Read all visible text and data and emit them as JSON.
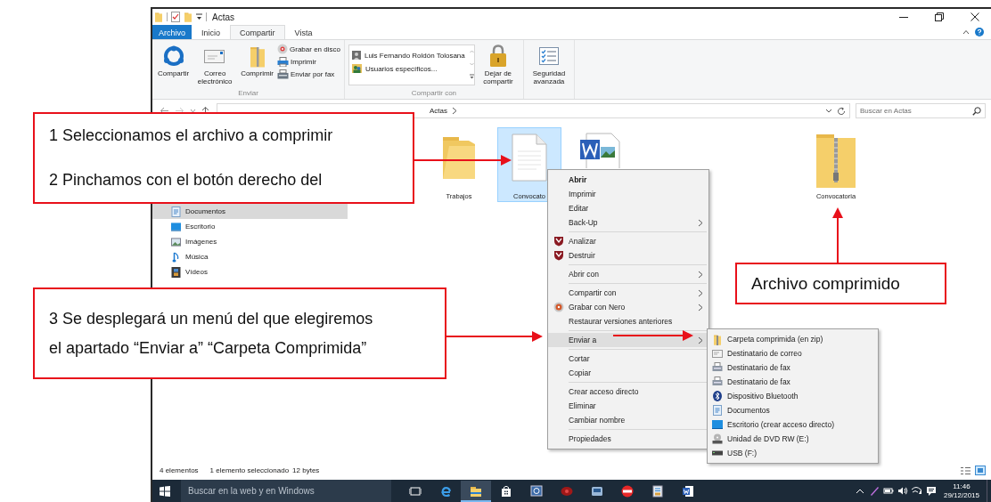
{
  "window": {
    "title": "Actas"
  },
  "ribbon_tabs": [
    {
      "label": "Archivo",
      "kind": "file",
      "selected": false
    },
    {
      "label": "Inicio",
      "kind": "tab",
      "selected": false
    },
    {
      "label": "Compartir",
      "kind": "tab",
      "selected": true
    },
    {
      "label": "Vista",
      "kind": "tab",
      "selected": false
    }
  ],
  "ribbon": {
    "send_group": {
      "label": "Enviar",
      "large_buttons": [
        "Compartir",
        "Correo electrónico",
        "Comprimir"
      ],
      "small_buttons": [
        "Grabar en disco",
        "Imprimir",
        "Enviar por fax"
      ]
    },
    "share_group": {
      "label": "Compartir con",
      "people": [
        "Luis Fernando Roldón Tolosana",
        "Usuarios específicos..."
      ],
      "stop_button": "Dejar de compartir"
    },
    "security_button": "Seguridad avanzada"
  },
  "address_bar": {
    "breadcrumb": [
      "Actas"
    ],
    "search_placeholder": "Buscar en Actas"
  },
  "nav_items": [
    {
      "label": "Documentos",
      "selected": true
    },
    {
      "label": "Escritorio",
      "selected": false
    },
    {
      "label": "Imágenes",
      "selected": false
    },
    {
      "label": "Música",
      "selected": false
    },
    {
      "label": "Vídeos",
      "selected": false
    }
  ],
  "files": [
    {
      "label": "Trabajos",
      "kind": "folder",
      "selected": false
    },
    {
      "label": "Convocato",
      "kind": "text",
      "selected": true
    },
    {
      "kind": "word",
      "selected": false
    },
    {
      "label": "Convocatoria",
      "kind": "zip",
      "selected": false
    }
  ],
  "context_menu": [
    [
      {
        "label": "Abrir",
        "kind": "default",
        "submenu": false,
        "selected": false
      },
      {
        "label": "Imprimir",
        "kind": "plain",
        "submenu": false,
        "selected": false
      },
      {
        "label": "Editar",
        "kind": "plain",
        "submenu": false,
        "selected": false
      },
      {
        "label": "Back-Up",
        "kind": "plain",
        "submenu": true,
        "selected": false
      }
    ],
    [
      {
        "label": "Analizar",
        "kind": "shield",
        "submenu": false,
        "selected": false
      },
      {
        "label": "Destruir",
        "kind": "shield",
        "submenu": false,
        "selected": false
      }
    ],
    [
      {
        "label": "Abrir con",
        "kind": "plain",
        "submenu": true,
        "selected": false
      }
    ],
    [
      {
        "label": "Compartir con",
        "kind": "plain",
        "submenu": true,
        "selected": false
      },
      {
        "label": "Grabar con Nero",
        "kind": "nero",
        "submenu": true,
        "selected": false
      },
      {
        "label": "Restaurar versiones anteriores",
        "kind": "plain",
        "submenu": false,
        "selected": false
      }
    ],
    [
      {
        "label": "Enviar a",
        "kind": "plain",
        "submenu": true,
        "selected": true
      }
    ],
    [
      {
        "label": "Cortar",
        "kind": "plain",
        "submenu": false,
        "selected": false
      },
      {
        "label": "Copiar",
        "kind": "plain",
        "submenu": false,
        "selected": false
      }
    ],
    [
      {
        "label": "Crear acceso directo",
        "kind": "plain",
        "submenu": false,
        "selected": false
      },
      {
        "label": "Eliminar",
        "kind": "plain",
        "submenu": false,
        "selected": false
      },
      {
        "label": "Cambiar nombre",
        "kind": "plain",
        "submenu": false,
        "selected": false
      }
    ],
    [
      {
        "label": "Propiedades",
        "kind": "plain",
        "submenu": false,
        "selected": false
      }
    ]
  ],
  "send_to_menu": [
    {
      "label": "Carpeta comprimida (en zip)",
      "kind": "zip"
    },
    {
      "label": "Destinatario de correo",
      "kind": "mail"
    },
    {
      "label": "Destinatario de fax",
      "kind": "fax"
    },
    {
      "label": "Destinatario de fax",
      "kind": "fax"
    },
    {
      "label": "Dispositivo Bluetooth",
      "kind": "bluetooth"
    },
    {
      "label": "Documentos",
      "kind": "documents"
    },
    {
      "label": "Escritorio (crear acceso directo)",
      "kind": "desktop"
    },
    {
      "label": "Unidad de DVD RW (E:)",
      "kind": "dvd"
    },
    {
      "label": "USB (F:)",
      "kind": "usb"
    }
  ],
  "status_bar": {
    "count": "4 elementos",
    "selection": "1 elemento seleccionado",
    "size": "12 bytes"
  },
  "taskbar": {
    "search_placeholder": "Buscar en la web y en Windows",
    "time": "11:46",
    "date": "29/12/2015"
  },
  "callouts": [
    {
      "kind": "steps-top",
      "lines": [
        "1 Seleccionamos el archivo a comprimir",
        "2 Pinchamos con el botón derecho del"
      ]
    },
    {
      "kind": "steps-bottom",
      "lines": [
        "3 Se desplegará un menú del que elegiremos",
        "el apartado “Enviar a” “Carpeta Comprimida”"
      ]
    },
    {
      "kind": "result",
      "lines": [
        "Archivo comprimido"
      ]
    }
  ]
}
